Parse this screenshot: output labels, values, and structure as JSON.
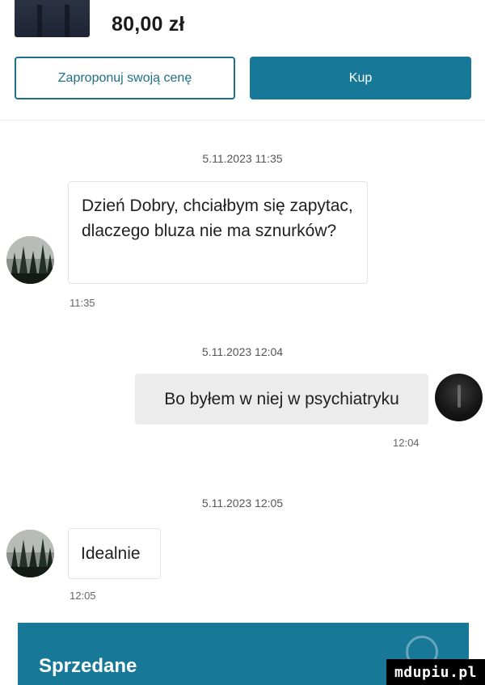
{
  "product": {
    "price": "80,00 zł"
  },
  "actions": {
    "offer_label": "Zaproponuj swoją cenę",
    "buy_label": "Kup"
  },
  "messages": [
    {
      "date": "5.11.2023 11:35",
      "text": "Dzień Dobry, chciałbym się zapytac, dlaczego bluza nie ma sznurków?",
      "time": "11:35",
      "direction": "incoming"
    },
    {
      "date": "5.11.2023 12:04",
      "text": "Bo byłem w niej w psychiatryku",
      "time": "12:04",
      "direction": "outgoing"
    },
    {
      "date": "5.11.2023 12:05",
      "text": "Idealnie",
      "time": "12:05",
      "direction": "incoming"
    }
  ],
  "bottom_bar": {
    "title": "Sprzedane"
  },
  "watermark": {
    "text": "mdupiu.pl"
  },
  "colors": {
    "accent": "#177997",
    "outgoing_bubble": "#ececec",
    "text": "#1f1f1f"
  },
  "icons": {
    "contact_avatar": "forest-avatar-icon",
    "user_avatar": "dark-avatar-icon",
    "search": "search-icon"
  }
}
